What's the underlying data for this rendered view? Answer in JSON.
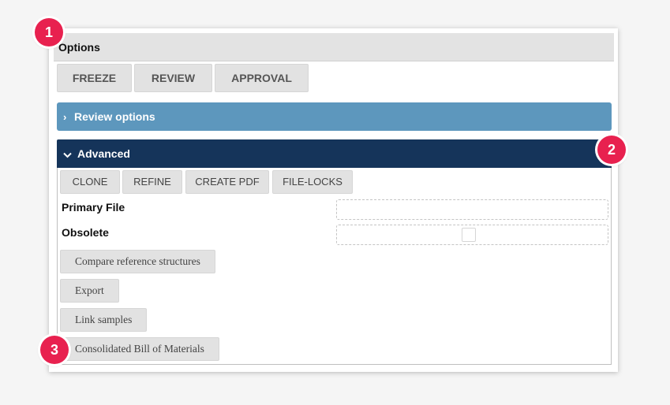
{
  "panel": {
    "title": "Options"
  },
  "toolbar": {
    "freeze_label": "FREEZE",
    "review_label": "REVIEW",
    "approval_label": "APPROVAL"
  },
  "review_section": {
    "chevron": "›",
    "label": "Review options"
  },
  "advanced_section": {
    "chevron": "⌄",
    "label": "Advanced",
    "buttons": {
      "clone": "CLONE",
      "refine": "REFINE",
      "create_pdf": "CREATE PDF",
      "file_locks": "FILE-LOCKS"
    },
    "fields": {
      "primary_file_label": "Primary File",
      "primary_file_value": "",
      "obsolete_label": "Obsolete",
      "obsolete_checked": false
    },
    "actions": {
      "compare": "Compare reference structures",
      "export": "Export",
      "link_samples": "Link samples",
      "consolidated_bom": "Consolidated Bill of Materials"
    }
  },
  "markers": {
    "one": "1",
    "two": "2",
    "three": "3"
  },
  "colors": {
    "review_bar": "#5d97bd",
    "advanced_bar": "#15345a",
    "marker": "#e8214f"
  }
}
